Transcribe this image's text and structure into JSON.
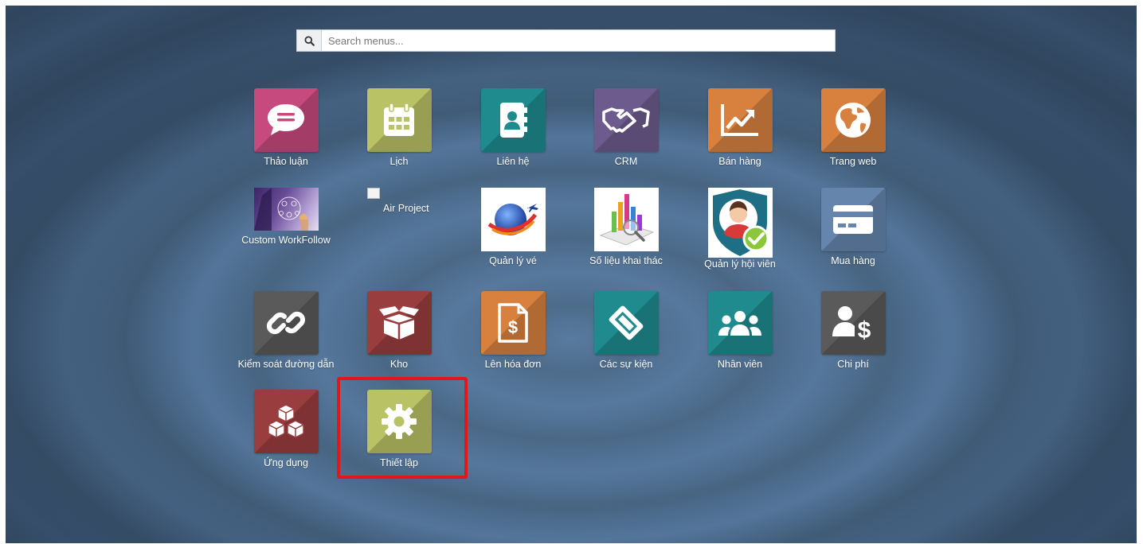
{
  "search": {
    "placeholder": "Search menus...",
    "icon": "search-icon"
  },
  "apps": [
    {
      "label": "Thảo luận",
      "color": "#c74a7e",
      "icon": "chat-icon"
    },
    {
      "label": "Lịch",
      "color": "#b9c264",
      "icon": "calendar-icon"
    },
    {
      "label": "Liên hệ",
      "color": "#1f8b8f",
      "icon": "contacts-icon"
    },
    {
      "label": "CRM",
      "color": "#6e5b8d",
      "icon": "handshake-icon"
    },
    {
      "label": "Bán hàng",
      "color": "#d8813f",
      "icon": "sales-chart-icon"
    },
    {
      "label": "Trang web",
      "color": "#d8813f",
      "icon": "globe-icon"
    },
    {
      "label": "Custom WorkFollow",
      "icon": "workflow-image"
    },
    {
      "label": "Air Project",
      "icon": "broken-image-icon"
    },
    {
      "label": "Quản lý vé",
      "icon": "ticket-globe-image"
    },
    {
      "label": "Số liệu khai thác",
      "icon": "statistics-image"
    },
    {
      "label": "Quản lý hội viên",
      "icon": "member-shield-image"
    },
    {
      "label": "Mua hàng",
      "color": "#6585ad",
      "icon": "credit-card-icon"
    },
    {
      "label": "Kiểm soát đường dẫn",
      "color": "#5a5a5a",
      "icon": "link-icon"
    },
    {
      "label": "Kho",
      "color": "#9a3d3f",
      "icon": "box-icon"
    },
    {
      "label": "Lên hóa đơn",
      "color": "#d8813f",
      "icon": "invoice-icon"
    },
    {
      "label": "Các sự kiện",
      "color": "#1f8b8f",
      "icon": "ticket-icon"
    },
    {
      "label": "Nhân viên",
      "color": "#1f8b8f",
      "icon": "users-icon"
    },
    {
      "label": "Chi phí",
      "color": "#5a5a5a",
      "icon": "expense-icon"
    },
    {
      "label": "Ứng dụng",
      "color": "#9a3d3f",
      "icon": "apps-cubes-icon"
    },
    {
      "label": "Thiết lập",
      "color": "#b9c264",
      "icon": "gear-icon"
    }
  ],
  "highlight_color": "#e6141b"
}
